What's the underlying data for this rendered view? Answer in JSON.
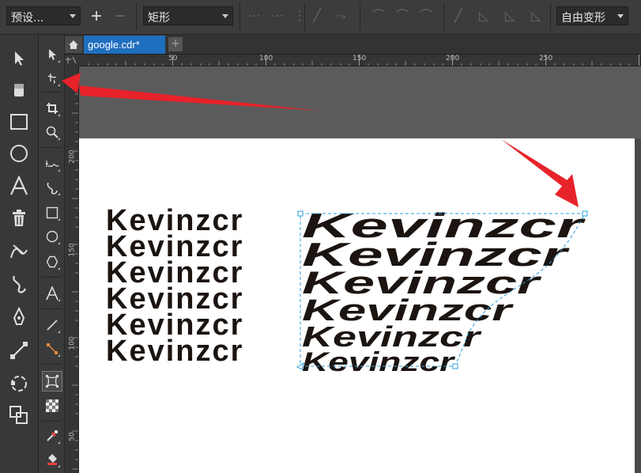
{
  "propertybar": {
    "preset_label": "预设...",
    "shape_label": "矩形",
    "transform_label": "自由变形"
  },
  "document": {
    "tab_title": "google.cdr*"
  },
  "ruler": {
    "top_labels": [
      "50",
      "100",
      "150",
      "200",
      "250"
    ],
    "left_labels": [
      "200",
      "150",
      "100",
      "50"
    ]
  },
  "canvas_text": {
    "lines": [
      "Kevinzcr",
      "Kevinzcr",
      "Kevinzcr",
      "Kevinzcr",
      "Kevinzcr",
      "Kevinzcr"
    ]
  },
  "colors": {
    "accent_tab": "#1f6fbf",
    "annotation_arrow": "#e8222a",
    "text": "#1b1410"
  },
  "icons": {
    "toolbox_main": [
      "pick-icon",
      "eraser-icon",
      "rectangle-icon",
      "ellipse-icon",
      "text-icon",
      "delete-icon",
      "artistic-media-icon",
      "bspline-icon",
      "pen-icon",
      "connector-icon",
      "smart-drawing-icon",
      "shape-icon"
    ],
    "toolbox_secondary": [
      "pick-icon",
      "shape-edit-icon",
      "crop-icon",
      "zoom-icon",
      "freehand-icon",
      "curve-icon",
      "rectangle-icon",
      "ellipse-icon",
      "polygon-icon",
      "text-icon",
      "dimension-icon",
      "connector-icon",
      "envelope-icon",
      "transparency-icon",
      "eyedropper-icon",
      "fill-icon"
    ]
  }
}
